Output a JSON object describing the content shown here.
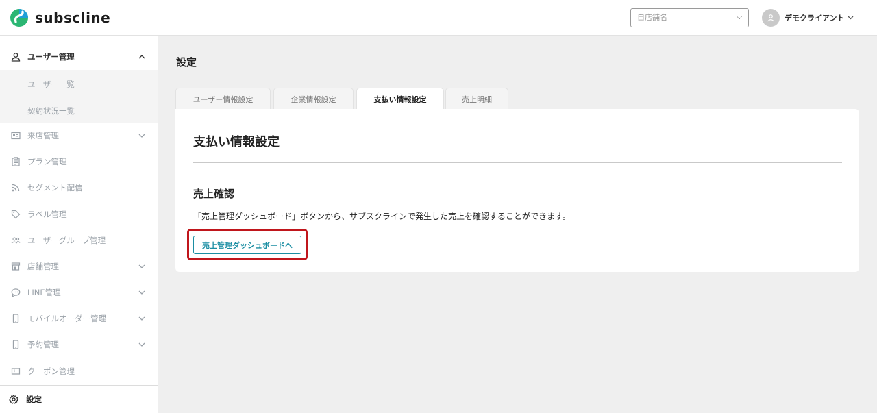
{
  "app": {
    "logo_text": "subscline"
  },
  "header": {
    "store_select": {
      "placeholder": "自店舗名"
    },
    "user_name": "デモクライアント"
  },
  "sidebar": {
    "items": [
      {
        "label": "ユーザー管理",
        "icon": "person-icon",
        "expanded": true
      },
      {
        "label": "来店管理",
        "icon": "id-card-icon"
      },
      {
        "label": "プラン管理",
        "icon": "clipboard-icon"
      },
      {
        "label": "セグメント配信",
        "icon": "rss-icon"
      },
      {
        "label": "ラベル管理",
        "icon": "tag-icon"
      },
      {
        "label": "ユーザーグループ管理",
        "icon": "people-icon"
      },
      {
        "label": "店舗管理",
        "icon": "store-icon"
      },
      {
        "label": "LINE管理",
        "icon": "chat-icon"
      },
      {
        "label": "モバイルオーダー管理",
        "icon": "phone-icon"
      },
      {
        "label": "予約管理",
        "icon": "phone-icon"
      },
      {
        "label": "クーポン管理",
        "icon": "ticket-icon"
      }
    ],
    "subitems": [
      "ユーザー一覧",
      "契約状況一覧"
    ],
    "settings_label": "設定"
  },
  "main": {
    "page_title": "設定",
    "tabs": [
      {
        "label": "ユーザー情報設定"
      },
      {
        "label": "企業情報設定"
      },
      {
        "label": "支払い情報設定",
        "active": true
      },
      {
        "label": "売上明細"
      }
    ],
    "card": {
      "title": "支払い情報設定",
      "section_title": "売上確認",
      "description": "「売上管理ダッシュボード」ボタンから、サブスクラインで発生した売上を確認することができます。",
      "button_label": "売上管理ダッシュボードへ"
    }
  },
  "colors": {
    "accent": "#1b8ea3",
    "highlight": "#c0161c"
  }
}
